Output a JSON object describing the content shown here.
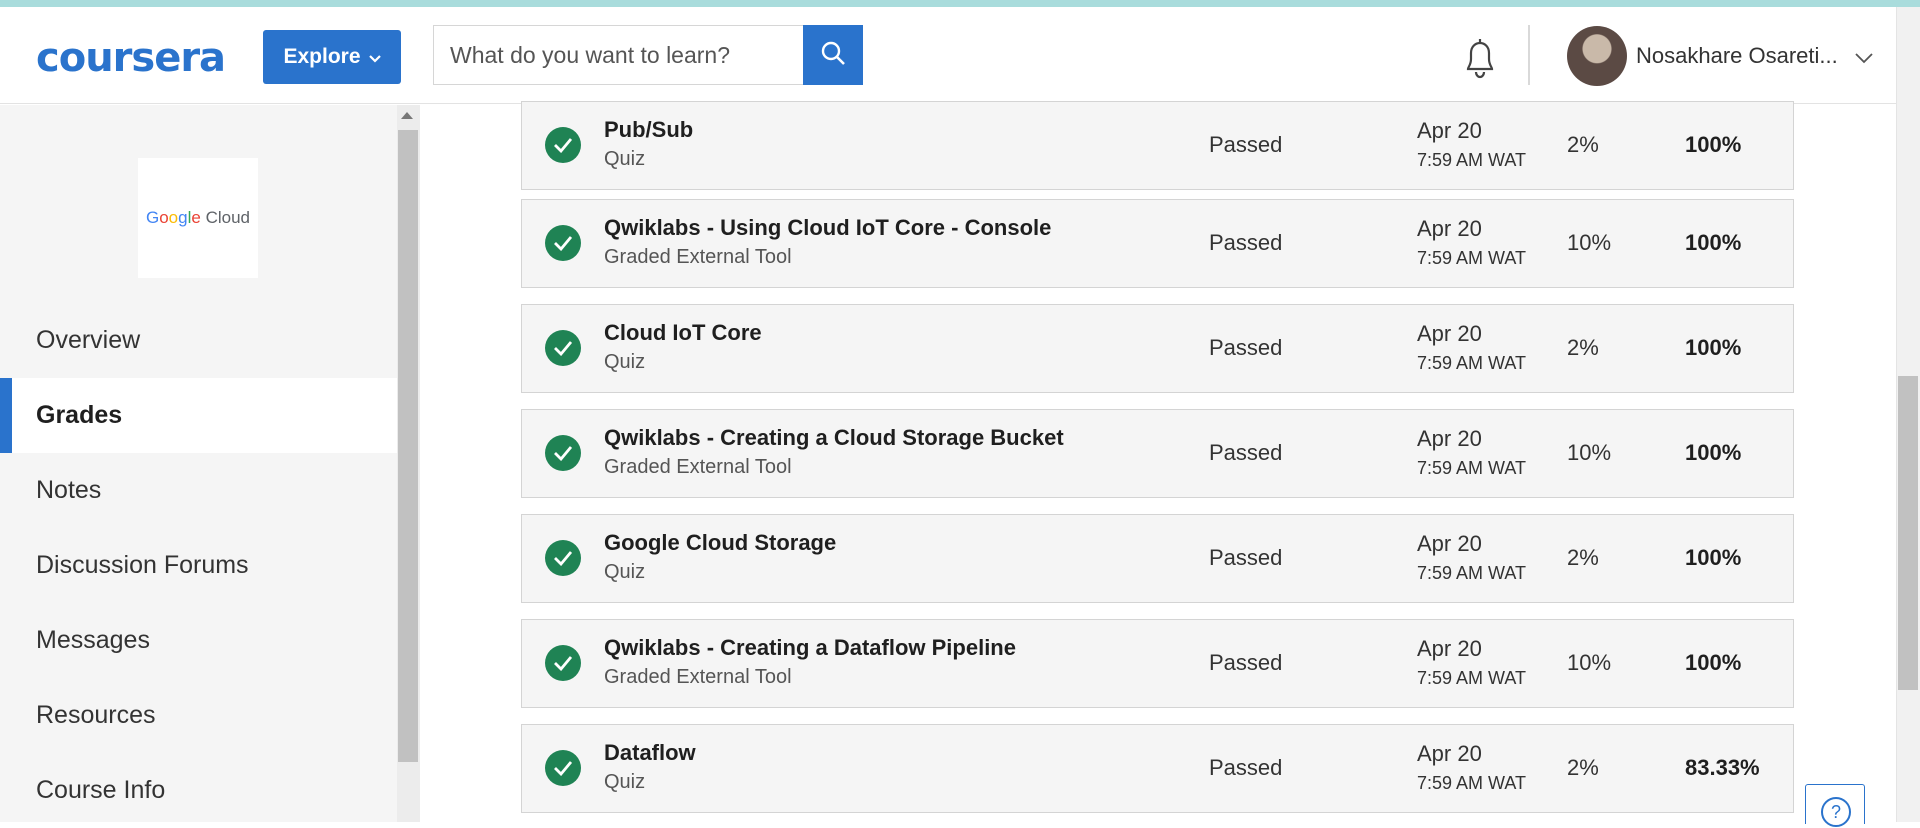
{
  "header": {
    "logo_text": "coursera",
    "explore_label": "Explore",
    "search_placeholder": "What do you want to learn?",
    "user_name": "Nosakhare Osareti..."
  },
  "sidebar": {
    "course_logo": {
      "brand": [
        "G",
        "o",
        "o",
        "g",
        "l",
        "e"
      ],
      "word": "Cloud"
    },
    "items": [
      {
        "label": "Overview"
      },
      {
        "label": "Grades"
      },
      {
        "label": "Notes"
      },
      {
        "label": "Discussion Forums"
      },
      {
        "label": "Messages"
      },
      {
        "label": "Resources"
      },
      {
        "label": "Course Info"
      }
    ],
    "active_index": 1
  },
  "grades": [
    {
      "title": "Pub/Sub",
      "type": "Quiz",
      "status": "Passed",
      "date": "Apr 20",
      "time": "7:59 AM WAT",
      "weight": "2%",
      "grade": "100%"
    },
    {
      "title": "Qwiklabs - Using Cloud IoT Core - Console",
      "type": "Graded External Tool",
      "status": "Passed",
      "date": "Apr 20",
      "time": "7:59 AM WAT",
      "weight": "10%",
      "grade": "100%"
    },
    {
      "title": "Cloud IoT Core",
      "type": "Quiz",
      "status": "Passed",
      "date": "Apr 20",
      "time": "7:59 AM WAT",
      "weight": "2%",
      "grade": "100%"
    },
    {
      "title": "Qwiklabs - Creating a Cloud Storage Bucket",
      "type": "Graded External Tool",
      "status": "Passed",
      "date": "Apr 20",
      "time": "7:59 AM WAT",
      "weight": "10%",
      "grade": "100%"
    },
    {
      "title": "Google Cloud Storage",
      "type": "Quiz",
      "status": "Passed",
      "date": "Apr 20",
      "time": "7:59 AM WAT",
      "weight": "2%",
      "grade": "100%"
    },
    {
      "title": "Qwiklabs - Creating a Dataflow Pipeline",
      "type": "Graded External Tool",
      "status": "Passed",
      "date": "Apr 20",
      "time": "7:59 AM WAT",
      "weight": "10%",
      "grade": "100%"
    },
    {
      "title": "Dataflow",
      "type": "Quiz",
      "status": "Passed",
      "date": "Apr 20",
      "time": "7:59 AM WAT",
      "weight": "2%",
      "grade": "83.33%"
    }
  ],
  "help_label": "?",
  "colors": {
    "brand": "#2a73cc",
    "passed": "#1f8354",
    "sidebar_bg": "#f5f5f5"
  },
  "icons": {
    "search": "search-icon",
    "bell": "bell-icon",
    "check": "check-circle-icon",
    "help": "help-icon"
  }
}
